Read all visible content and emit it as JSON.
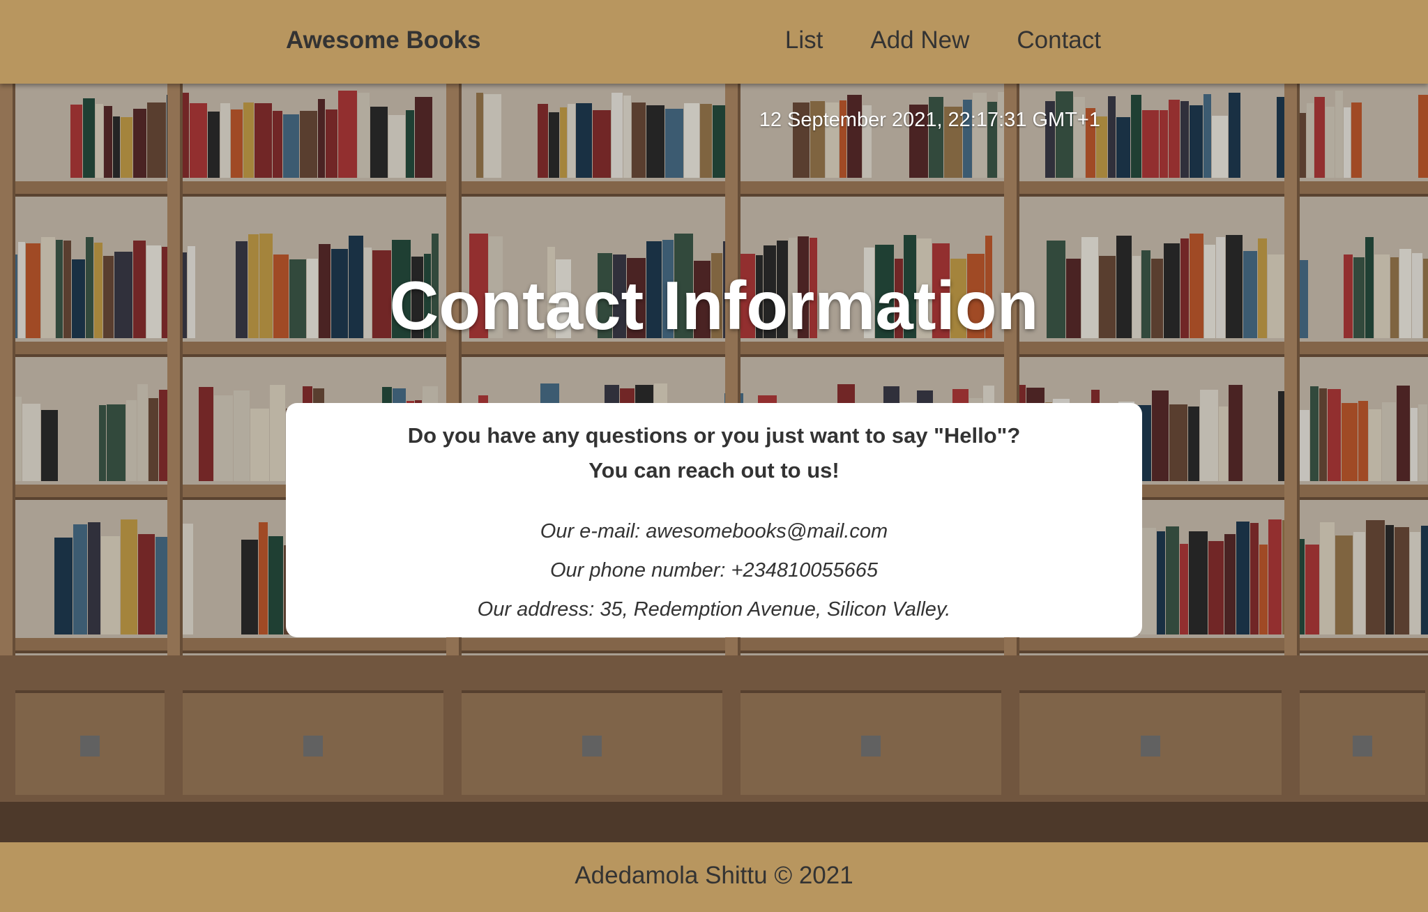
{
  "header": {
    "brand": "Awesome Books",
    "nav": [
      "List",
      "Add New",
      "Contact"
    ]
  },
  "hero": {
    "datetime": "12 September 2021, 22:17:31 GMT+1",
    "title": "Contact Information"
  },
  "contact_card": {
    "question": "Do you have any questions or you just want to say \"Hello\"?",
    "reach_out": "You can reach out to us!",
    "email": "Our e-mail: awesomebooks@mail.com",
    "phone": "Our phone number: +234810055665",
    "address": "Our address: 35, Redemption Avenue, Silicon Valley."
  },
  "footer": {
    "text": "Adedamola Shittu © 2021"
  },
  "colors": {
    "header_bg": "#b8965f",
    "footer_bg": "#b8965f",
    "text": "#333333",
    "card_bg": "#ffffff"
  }
}
